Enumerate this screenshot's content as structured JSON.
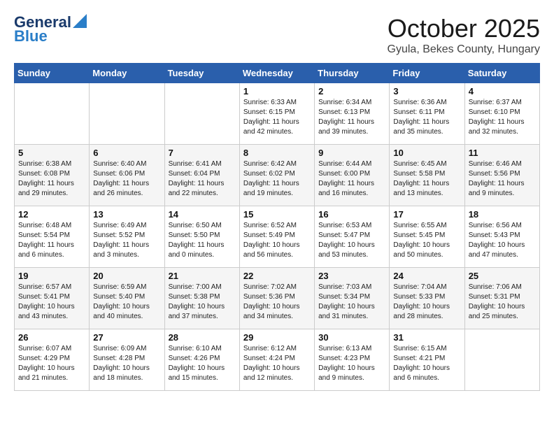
{
  "logo": {
    "line1": "General",
    "line2": "Blue"
  },
  "header": {
    "title": "October 2025",
    "subtitle": "Gyula, Bekes County, Hungary"
  },
  "weekdays": [
    "Sunday",
    "Monday",
    "Tuesday",
    "Wednesday",
    "Thursday",
    "Friday",
    "Saturday"
  ],
  "weeks": [
    [
      {
        "day": "",
        "detail": ""
      },
      {
        "day": "",
        "detail": ""
      },
      {
        "day": "",
        "detail": ""
      },
      {
        "day": "1",
        "detail": "Sunrise: 6:33 AM\nSunset: 6:15 PM\nDaylight: 11 hours and 42 minutes."
      },
      {
        "day": "2",
        "detail": "Sunrise: 6:34 AM\nSunset: 6:13 PM\nDaylight: 11 hours and 39 minutes."
      },
      {
        "day": "3",
        "detail": "Sunrise: 6:36 AM\nSunset: 6:11 PM\nDaylight: 11 hours and 35 minutes."
      },
      {
        "day": "4",
        "detail": "Sunrise: 6:37 AM\nSunset: 6:10 PM\nDaylight: 11 hours and 32 minutes."
      }
    ],
    [
      {
        "day": "5",
        "detail": "Sunrise: 6:38 AM\nSunset: 6:08 PM\nDaylight: 11 hours and 29 minutes."
      },
      {
        "day": "6",
        "detail": "Sunrise: 6:40 AM\nSunset: 6:06 PM\nDaylight: 11 hours and 26 minutes."
      },
      {
        "day": "7",
        "detail": "Sunrise: 6:41 AM\nSunset: 6:04 PM\nDaylight: 11 hours and 22 minutes."
      },
      {
        "day": "8",
        "detail": "Sunrise: 6:42 AM\nSunset: 6:02 PM\nDaylight: 11 hours and 19 minutes."
      },
      {
        "day": "9",
        "detail": "Sunrise: 6:44 AM\nSunset: 6:00 PM\nDaylight: 11 hours and 16 minutes."
      },
      {
        "day": "10",
        "detail": "Sunrise: 6:45 AM\nSunset: 5:58 PM\nDaylight: 11 hours and 13 minutes."
      },
      {
        "day": "11",
        "detail": "Sunrise: 6:46 AM\nSunset: 5:56 PM\nDaylight: 11 hours and 9 minutes."
      }
    ],
    [
      {
        "day": "12",
        "detail": "Sunrise: 6:48 AM\nSunset: 5:54 PM\nDaylight: 11 hours and 6 minutes."
      },
      {
        "day": "13",
        "detail": "Sunrise: 6:49 AM\nSunset: 5:52 PM\nDaylight: 11 hours and 3 minutes."
      },
      {
        "day": "14",
        "detail": "Sunrise: 6:50 AM\nSunset: 5:50 PM\nDaylight: 11 hours and 0 minutes."
      },
      {
        "day": "15",
        "detail": "Sunrise: 6:52 AM\nSunset: 5:49 PM\nDaylight: 10 hours and 56 minutes."
      },
      {
        "day": "16",
        "detail": "Sunrise: 6:53 AM\nSunset: 5:47 PM\nDaylight: 10 hours and 53 minutes."
      },
      {
        "day": "17",
        "detail": "Sunrise: 6:55 AM\nSunset: 5:45 PM\nDaylight: 10 hours and 50 minutes."
      },
      {
        "day": "18",
        "detail": "Sunrise: 6:56 AM\nSunset: 5:43 PM\nDaylight: 10 hours and 47 minutes."
      }
    ],
    [
      {
        "day": "19",
        "detail": "Sunrise: 6:57 AM\nSunset: 5:41 PM\nDaylight: 10 hours and 43 minutes."
      },
      {
        "day": "20",
        "detail": "Sunrise: 6:59 AM\nSunset: 5:40 PM\nDaylight: 10 hours and 40 minutes."
      },
      {
        "day": "21",
        "detail": "Sunrise: 7:00 AM\nSunset: 5:38 PM\nDaylight: 10 hours and 37 minutes."
      },
      {
        "day": "22",
        "detail": "Sunrise: 7:02 AM\nSunset: 5:36 PM\nDaylight: 10 hours and 34 minutes."
      },
      {
        "day": "23",
        "detail": "Sunrise: 7:03 AM\nSunset: 5:34 PM\nDaylight: 10 hours and 31 minutes."
      },
      {
        "day": "24",
        "detail": "Sunrise: 7:04 AM\nSunset: 5:33 PM\nDaylight: 10 hours and 28 minutes."
      },
      {
        "day": "25",
        "detail": "Sunrise: 7:06 AM\nSunset: 5:31 PM\nDaylight: 10 hours and 25 minutes."
      }
    ],
    [
      {
        "day": "26",
        "detail": "Sunrise: 6:07 AM\nSunset: 4:29 PM\nDaylight: 10 hours and 21 minutes."
      },
      {
        "day": "27",
        "detail": "Sunrise: 6:09 AM\nSunset: 4:28 PM\nDaylight: 10 hours and 18 minutes."
      },
      {
        "day": "28",
        "detail": "Sunrise: 6:10 AM\nSunset: 4:26 PM\nDaylight: 10 hours and 15 minutes."
      },
      {
        "day": "29",
        "detail": "Sunrise: 6:12 AM\nSunset: 4:24 PM\nDaylight: 10 hours and 12 minutes."
      },
      {
        "day": "30",
        "detail": "Sunrise: 6:13 AM\nSunset: 4:23 PM\nDaylight: 10 hours and 9 minutes."
      },
      {
        "day": "31",
        "detail": "Sunrise: 6:15 AM\nSunset: 4:21 PM\nDaylight: 10 hours and 6 minutes."
      },
      {
        "day": "",
        "detail": ""
      }
    ]
  ]
}
